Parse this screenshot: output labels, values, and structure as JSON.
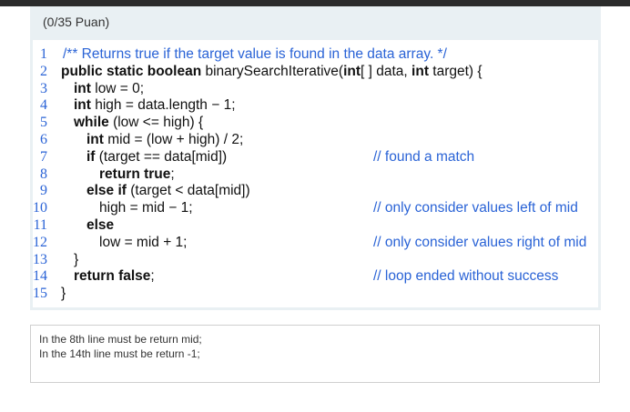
{
  "question": {
    "points": "(0/35 Puan)"
  },
  "code": {
    "lines": [
      {
        "num": "1",
        "indent": 0,
        "parts": [
          {
            "t": "/** Returns true if the target value is found in the data array. */",
            "k": "cm"
          }
        ],
        "comment": ""
      },
      {
        "num": "2",
        "indent": 0,
        "parts": [
          {
            "t": "public static boolean ",
            "k": "kw"
          },
          {
            "t": "binarySearchIterative(",
            "k": ""
          },
          {
            "t": "int",
            "k": "kw"
          },
          {
            "t": "[ ] data, ",
            "k": ""
          },
          {
            "t": "int",
            "k": "kw"
          },
          {
            "t": " target) {",
            "k": ""
          }
        ],
        "comment": ""
      },
      {
        "num": "3",
        "indent": 1,
        "parts": [
          {
            "t": "int",
            "k": "kw"
          },
          {
            "t": " low = 0;",
            "k": ""
          }
        ],
        "comment": ""
      },
      {
        "num": "4",
        "indent": 1,
        "parts": [
          {
            "t": "int",
            "k": "kw"
          },
          {
            "t": " high = data.length − 1;",
            "k": ""
          }
        ],
        "comment": ""
      },
      {
        "num": "5",
        "indent": 1,
        "parts": [
          {
            "t": "while",
            "k": "kw"
          },
          {
            "t": " (low <= high) {",
            "k": ""
          }
        ],
        "comment": ""
      },
      {
        "num": "6",
        "indent": 2,
        "parts": [
          {
            "t": "int",
            "k": "kw"
          },
          {
            "t": " mid = (low + high) / 2;",
            "k": ""
          }
        ],
        "comment": ""
      },
      {
        "num": "7",
        "indent": 2,
        "parts": [
          {
            "t": "if",
            "k": "kw"
          },
          {
            "t": " (target == data[mid])",
            "k": ""
          }
        ],
        "comment": "// found a match"
      },
      {
        "num": "8",
        "indent": 3,
        "parts": [
          {
            "t": "return true",
            "k": "kw"
          },
          {
            "t": ";",
            "k": ""
          }
        ],
        "comment": ""
      },
      {
        "num": "9",
        "indent": 2,
        "parts": [
          {
            "t": "else if",
            "k": "kw"
          },
          {
            "t": " (target < data[mid])",
            "k": ""
          }
        ],
        "comment": ""
      },
      {
        "num": "10",
        "indent": 3,
        "parts": [
          {
            "t": "high = mid − 1;",
            "k": ""
          }
        ],
        "comment": "// only consider values left of mid"
      },
      {
        "num": "11",
        "indent": 2,
        "parts": [
          {
            "t": "else",
            "k": "kw"
          }
        ],
        "comment": ""
      },
      {
        "num": "12",
        "indent": 3,
        "parts": [
          {
            "t": "low = mid + 1;",
            "k": ""
          }
        ],
        "comment": "// only consider values right of mid"
      },
      {
        "num": "13",
        "indent": 1,
        "parts": [
          {
            "t": "}",
            "k": ""
          }
        ],
        "comment": ""
      },
      {
        "num": "14",
        "indent": 1,
        "parts": [
          {
            "t": "return false",
            "k": "kw"
          },
          {
            "t": ";",
            "k": ""
          }
        ],
        "comment": "// loop ended without success"
      },
      {
        "num": "15",
        "indent": 0,
        "parts": [
          {
            "t": "}",
            "k": ""
          }
        ],
        "comment": ""
      }
    ]
  },
  "answer": {
    "lines": [
      "In the 8th line must be return mid;",
      "In the 14th line must be return -1;"
    ]
  },
  "colors": {
    "comment": "#2a63d6",
    "panel": "#e9f0f3",
    "topbar": "#2b2b2b"
  }
}
